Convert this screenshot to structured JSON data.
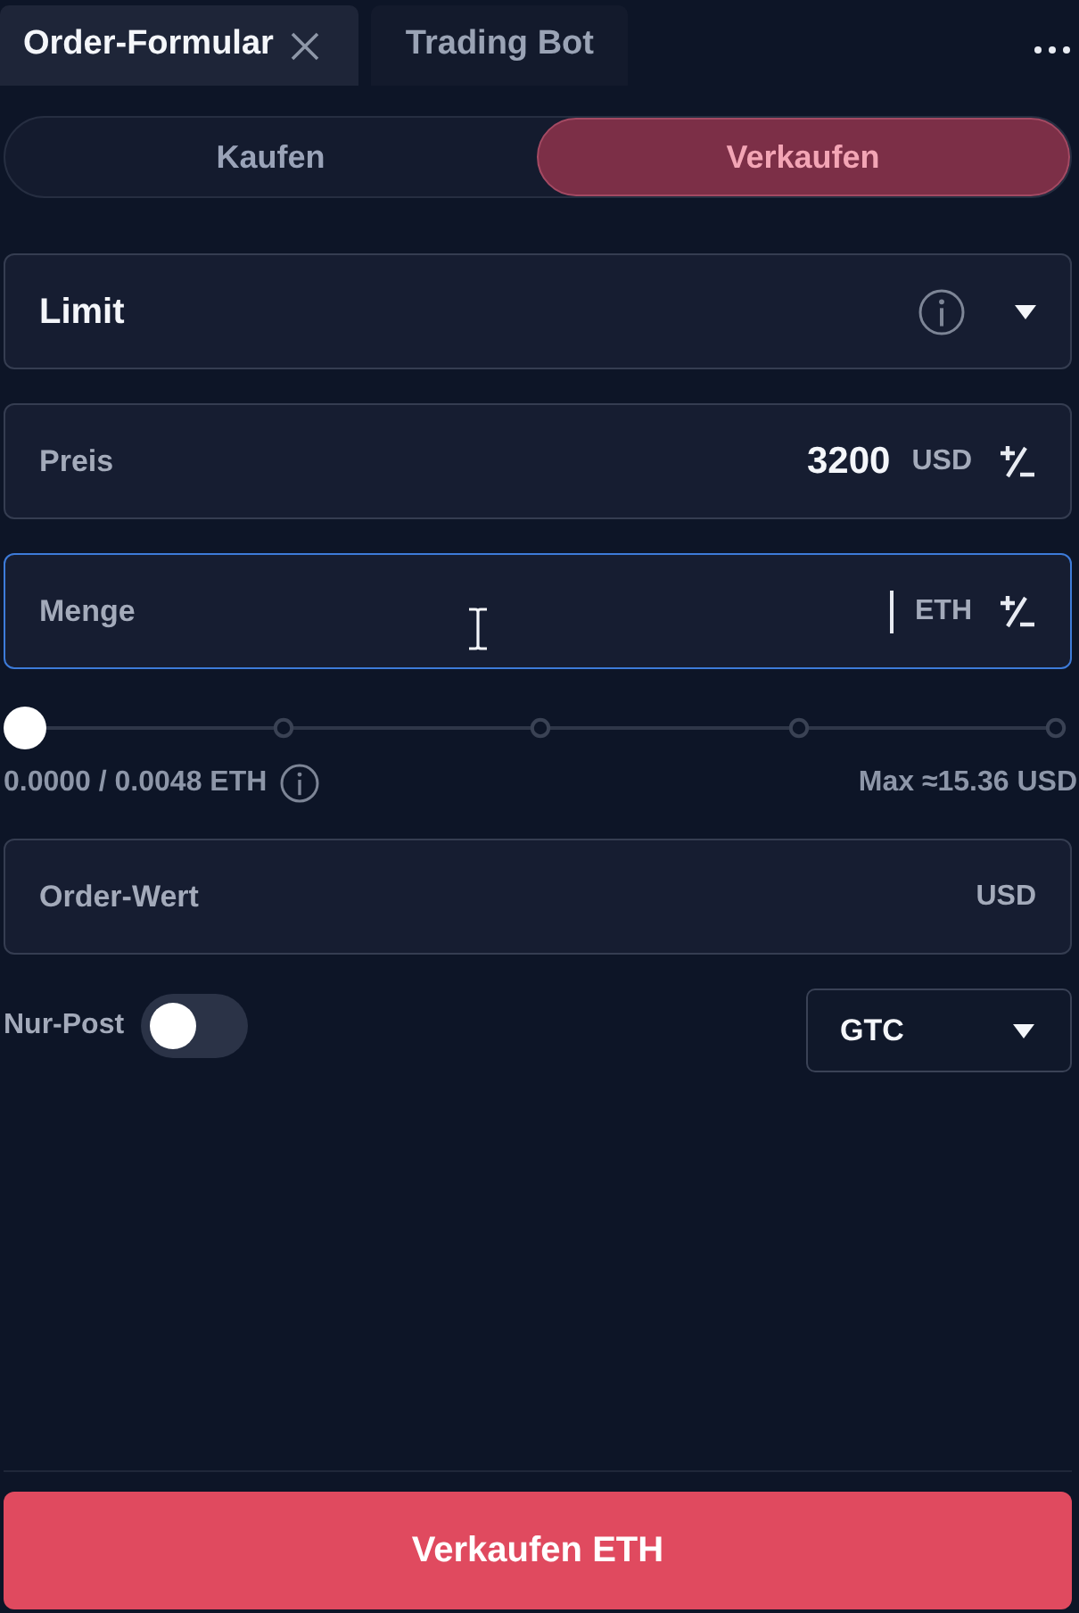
{
  "tabs": [
    {
      "label": "Order-Formular",
      "selected": true,
      "closable": true
    },
    {
      "label": "Trading Bot",
      "selected": false,
      "closable": false
    }
  ],
  "side_toggle": [
    {
      "label": "Kaufen",
      "selected": false
    },
    {
      "label": "Verkaufen",
      "selected": true
    }
  ],
  "order_type": {
    "value": "Limit"
  },
  "price": {
    "label": "Preis",
    "value": "3200",
    "unit": "USD"
  },
  "amount": {
    "label": "Menge",
    "unit": "ETH",
    "focused": true
  },
  "slider": {
    "level": 0
  },
  "balance": {
    "text": "0.0000 / 0.0048 ETH",
    "max": "Max ≈15.36 USD"
  },
  "order_value": {
    "label": "Order-Wert",
    "unit": "USD"
  },
  "post_only": {
    "label": "Nur-Post",
    "on": false
  },
  "time_in_force": {
    "value": "GTC"
  },
  "submit": {
    "label": "Verkaufen ETH"
  }
}
